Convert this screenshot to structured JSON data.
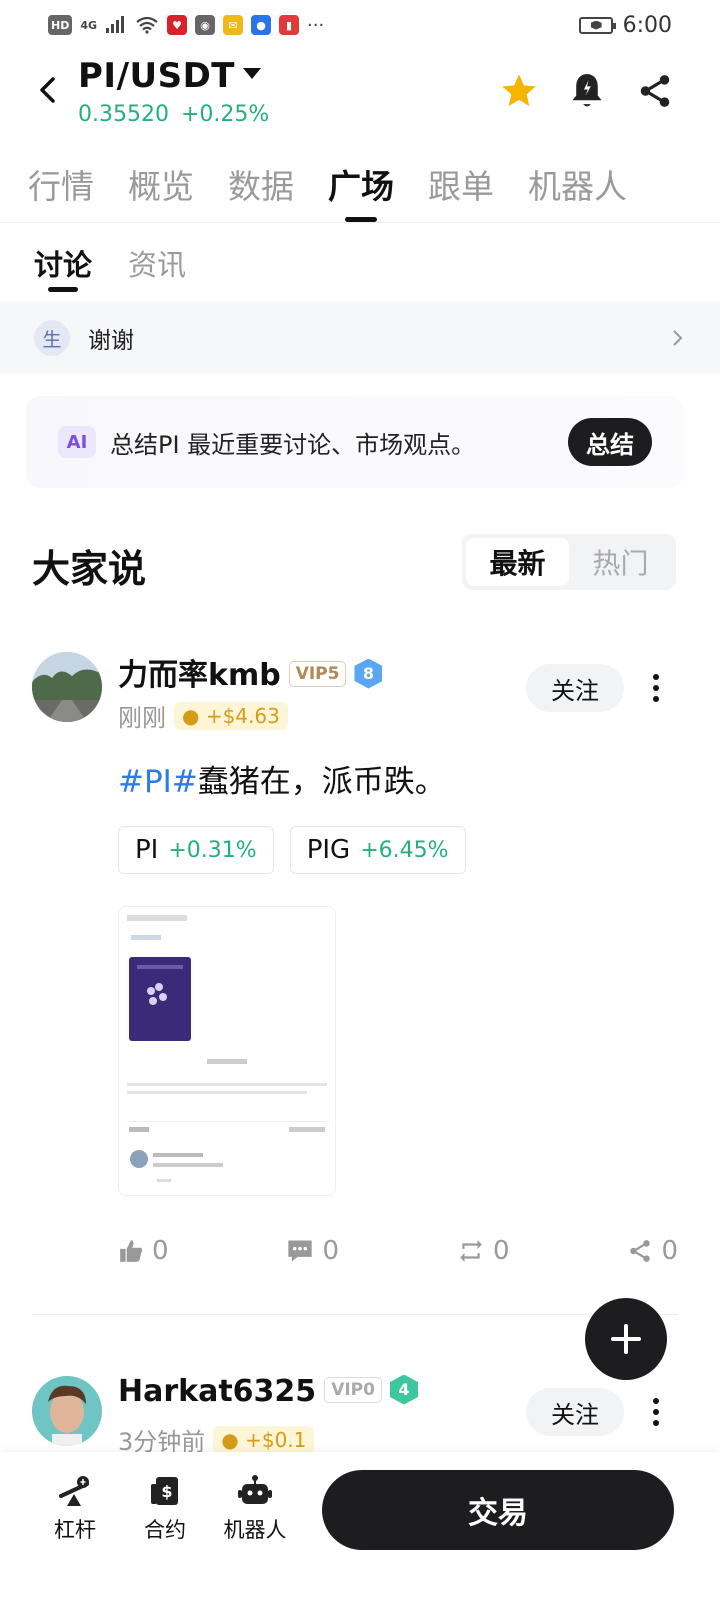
{
  "status_bar": {
    "left_icons": [
      "HD",
      "4G",
      "signal-icon",
      "wifi-icon",
      "app-icon-red",
      "wechat-icon",
      "mail-icon",
      "bulb-icon",
      "book-icon",
      "…"
    ],
    "network_hd": "HD",
    "network_4g": "4G",
    "overflow": "···",
    "time": "6:00"
  },
  "header": {
    "pair": "PI/USDT",
    "price": "0.35520",
    "change": "+0.25%",
    "colors": {
      "up": "#23b07d",
      "star": "#f5b400"
    }
  },
  "tabs": [
    {
      "label": "行情",
      "active": false
    },
    {
      "label": "概览",
      "active": false
    },
    {
      "label": "数据",
      "active": false
    },
    {
      "label": "广场",
      "active": true
    },
    {
      "label": "跟单",
      "active": false
    },
    {
      "label": "机器人",
      "active": false
    }
  ],
  "subtabs": [
    {
      "label": "讨论",
      "active": true
    },
    {
      "label": "资讯",
      "active": false
    }
  ],
  "ticker": {
    "badge": "生",
    "text": "谢谢"
  },
  "ai_card": {
    "badge": "AI",
    "text": "总结PI 最近重要讨论、市场观点。",
    "button": "总结"
  },
  "section": {
    "title": "大家说",
    "sort_options": [
      "最新",
      "热门"
    ],
    "active_sort": "最新"
  },
  "posts": [
    {
      "username": "力而率kmb",
      "vip": "VIP5",
      "level": "8",
      "time": "刚刚",
      "tip": "+$4.63",
      "follow": "关注",
      "hashtag": "#PI#",
      "text": "蠢猪在，派币跌。",
      "chips": [
        {
          "symbol": "PI",
          "change": "+0.31%"
        },
        {
          "symbol": "PIG",
          "change": "+6.45%"
        }
      ],
      "likes": "0",
      "comments": "0",
      "reposts": "0",
      "shares": "0"
    },
    {
      "username": "Harkat6325",
      "vip": "VIP0",
      "level": "4",
      "time": "3分钟前",
      "tip": "+$0.1",
      "follow": "关注"
    }
  ],
  "bottom_nav": {
    "items": [
      {
        "label": "杠杆",
        "icon": "leverage-icon"
      },
      {
        "label": "合约",
        "icon": "contract-icon"
      },
      {
        "label": "机器人",
        "icon": "robot-icon"
      }
    ],
    "trade_button": "交易"
  }
}
